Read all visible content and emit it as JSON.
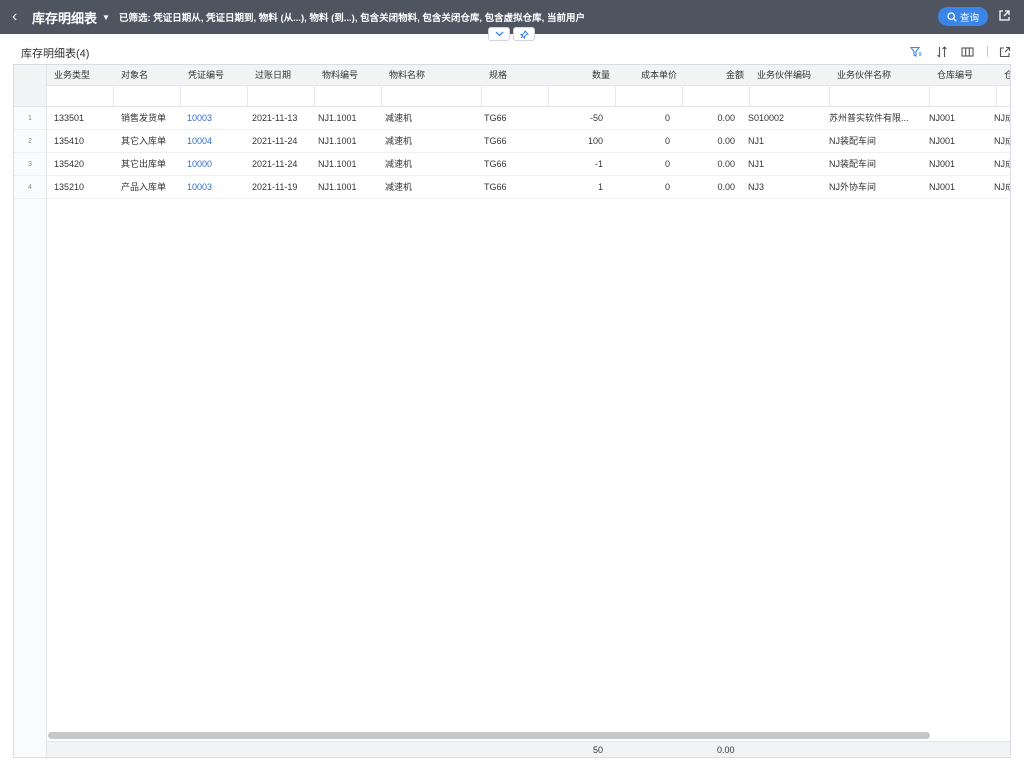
{
  "header": {
    "title": "库存明细表",
    "filter_text": "已筛选: 凭证日期从, 凭证日期到, 物料 (从...), 物料 (到...), 包含关闭物料, 包含关闭仓库, 包含虚拟仓库, 当前用户",
    "query_label": "查询"
  },
  "sub_title": "库存明细表(4)",
  "columns": [
    "业务类型",
    "对象名",
    "凭证编号",
    "过账日期",
    "物料编号",
    "物料名称",
    "规格",
    "数量",
    "成本单价",
    "金额",
    "业务伙伴编码",
    "业务伙伴名称",
    "仓库编号",
    "仓"
  ],
  "rows": [
    {
      "idx": "1",
      "biz": "133501",
      "obj": "销售发货单",
      "doc": "10003",
      "date": "2021-11-13",
      "item": "NJ1.1001",
      "name": "减速机",
      "spec": "TG66",
      "qty": "-50",
      "cost": "0",
      "amt": "0.00",
      "bp": "S010002",
      "bpname": "苏州普实软件有限...",
      "wh": "NJ001",
      "wh2": "NJ成"
    },
    {
      "idx": "2",
      "biz": "135410",
      "obj": "其它入库单",
      "doc": "10004",
      "date": "2021-11-24",
      "item": "NJ1.1001",
      "name": "减速机",
      "spec": "TG66",
      "qty": "100",
      "cost": "0",
      "amt": "0.00",
      "bp": "NJ1",
      "bpname": "NJ装配车间",
      "wh": "NJ001",
      "wh2": "NJ成"
    },
    {
      "idx": "3",
      "biz": "135420",
      "obj": "其它出库单",
      "doc": "10000",
      "date": "2021-11-24",
      "item": "NJ1.1001",
      "name": "减速机",
      "spec": "TG66",
      "qty": "-1",
      "cost": "0",
      "amt": "0.00",
      "bp": "NJ1",
      "bpname": "NJ装配车间",
      "wh": "NJ001",
      "wh2": "NJ成"
    },
    {
      "idx": "4",
      "biz": "135210",
      "obj": "产品入库单",
      "doc": "10003",
      "date": "2021-11-19",
      "item": "NJ1.1001",
      "name": "减速机",
      "spec": "TG66",
      "qty": "1",
      "cost": "0",
      "amt": "0.00",
      "bp": "NJ3",
      "bpname": "NJ外协车间",
      "wh": "NJ001",
      "wh2": "NJ成"
    }
  ],
  "totals": {
    "qty": "50",
    "amt": "0.00"
  },
  "colors": {
    "topbar": "#4e5561",
    "accent": "#3a86e8",
    "link": "#2f6ec2"
  }
}
